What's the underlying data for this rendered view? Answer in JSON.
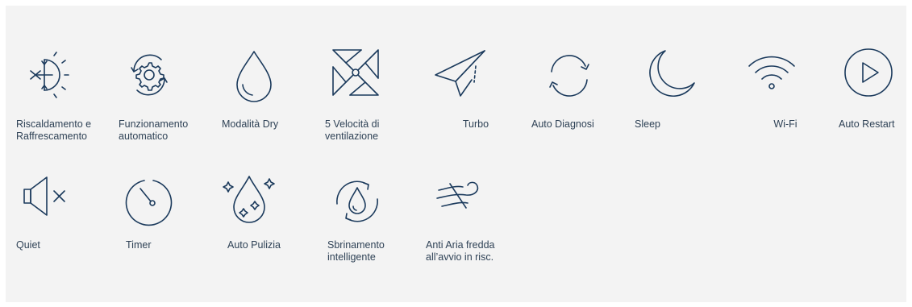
{
  "colors": {
    "panel_bg": "#f3f3f3",
    "icon_stroke": "#1b3a5c",
    "label_text": "#2f4256"
  },
  "features": [
    {
      "icon": "sun-snowflake-icon",
      "label": "Riscaldamento e\nRaffrescamento"
    },
    {
      "icon": "gear-cycle-icon",
      "label": "Funzionamento\nautomatico"
    },
    {
      "icon": "droplet-icon",
      "label": "Modalità Dry"
    },
    {
      "icon": "pinwheel-icon",
      "label": "5 Velocità di\nventilazione"
    },
    {
      "icon": "paper-plane-icon",
      "label": "Turbo"
    },
    {
      "icon": "refresh-arrows-icon",
      "label": "Auto Diagnosi"
    },
    {
      "icon": "crescent-moon-icon",
      "label": "Sleep"
    },
    {
      "icon": "wifi-icon",
      "label": "Wi-Fi"
    },
    {
      "icon": "play-circle-icon",
      "label": "Auto Restart"
    },
    {
      "icon": "speaker-mute-icon",
      "label": "Quiet"
    },
    {
      "icon": "timer-icon",
      "label": "Timer"
    },
    {
      "icon": "sparkling-droplet-icon",
      "label": "Auto Pulizia"
    },
    {
      "icon": "droplet-cycle-icon",
      "label": "Sbrinamento\nintelligente"
    },
    {
      "icon": "wind-icon",
      "label": "Anti Aria fredda\nall’avvio in risc."
    }
  ]
}
